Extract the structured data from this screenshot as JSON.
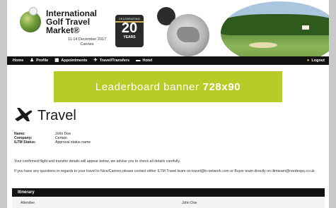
{
  "header": {
    "logo_lines": [
      "International",
      "Golf Travel",
      "Market®"
    ],
    "date": "11-14 December 2017",
    "city": "Cannes",
    "badge": {
      "top": "CELEBRATING",
      "number": "20",
      "bottom": "YEARS"
    }
  },
  "nav": {
    "items": [
      {
        "label": "Home",
        "icon": ""
      },
      {
        "label": "Profile",
        "icon": "person-icon"
      },
      {
        "label": "Appointments",
        "icon": "calendar-icon"
      },
      {
        "label": "Travel/Transfers",
        "icon": "plane-icon"
      },
      {
        "label": "Hotel",
        "icon": "bed-icon"
      }
    ],
    "logout": "Logout"
  },
  "banner": {
    "text": "Leaderboard banner",
    "size": "728x90",
    "color": "#b7cc26"
  },
  "travel": {
    "title": "Travel",
    "details": [
      {
        "label": "Name:",
        "value": "John Doe"
      },
      {
        "label": "Company:",
        "value": "Certain"
      },
      {
        "label": "ILTM Status:",
        "value": "Approval status name"
      }
    ],
    "para1": "Your confirmed flight and transfer details will appear below, we advise you to check all details carefully.",
    "para2": "If you have any questions in regards to your travel to Nice/Cannes please contact either ILTM Travel team on travel@ls-network.com or Buyer team directly on iltmteam@reedexpo.co.uk"
  },
  "itinerary": {
    "title": "Itinerary",
    "row": {
      "label": "Attendee",
      "value": "John Doe"
    }
  }
}
